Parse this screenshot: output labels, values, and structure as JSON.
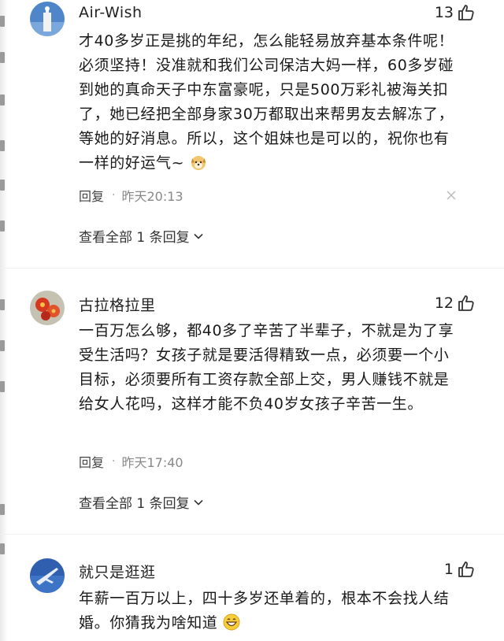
{
  "comments": [
    {
      "username": "Air-Wish",
      "likes": "13",
      "text": "才40多岁正是挑的年纪，怎么能轻易放弃基本条件呢！必须坚持！没准就和我们公司保洁大妈一样，60多岁碰到她的真命天子中东富豪呢，只是500万彩礼被海关扣了，她已经把全部身家30万都取出来帮男友去解冻了，等她的好消息。所以，这个姐妹也是可以的，祝你也有一样的好运气~",
      "reply_label": "回复",
      "separator": "·",
      "time": "昨天20:13",
      "view_all": "查看全部 1 条回复",
      "avatar_icon": "statue-avatar",
      "emoji_icon": "dog-face-emoji"
    },
    {
      "username": "古拉格拉里",
      "likes": "12",
      "text": "一百万怎么够，都40多了辛苦了半辈子，不就是为了享受生活吗？女孩子就是要活得精致一点，必须要一个小目标，必须要所有工资存款全部上交，男人赚钱不就是给女人花吗，这样才能不负40岁女孩子辛苦一生。",
      "reply_label": "回复",
      "separator": "·",
      "time": "昨天17:40",
      "view_all": "查看全部 1 条回复",
      "avatar_icon": "red-flower-avatar"
    },
    {
      "username": "就只是逛逛",
      "likes": "1",
      "text": "年薪一百万以上，四十多岁还单着的，根本不会找人结婚。你猜我为啥知道",
      "avatar_icon": "fighter-jet-avatar",
      "emoji_icon": "grinning-face-emoji"
    }
  ]
}
